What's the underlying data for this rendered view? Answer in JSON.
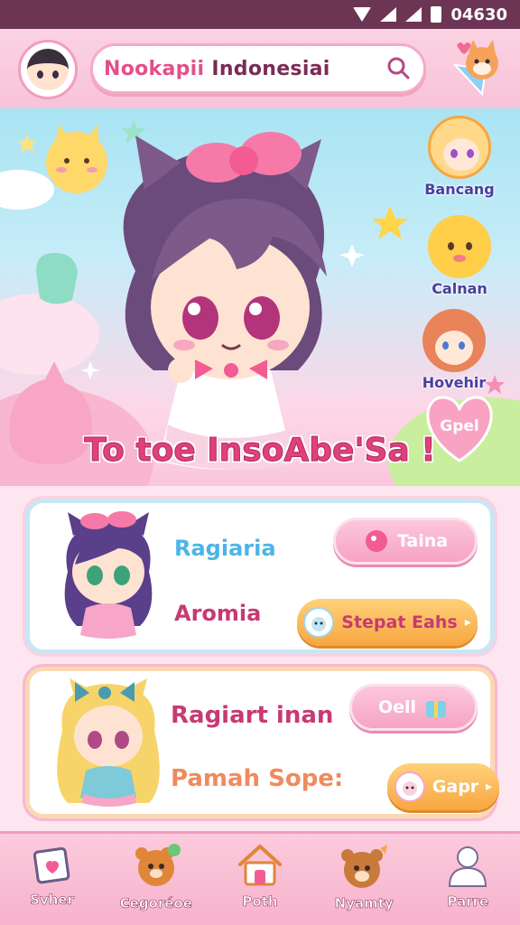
{
  "status_bar": {
    "time": "04630"
  },
  "header": {
    "title_part1": "Nookapii",
    "title_part2": "Indonesiai",
    "icons": [
      "avatar",
      "search-icon",
      "fox-badge-icon"
    ]
  },
  "hero": {
    "tagline": "To toe InsoAbe'Sa !",
    "side_characters": [
      {
        "label": "Bancang"
      },
      {
        "label": "Calnan"
      },
      {
        "label": "Hovehir"
      }
    ],
    "heart_button": "Gpel"
  },
  "cards": [
    {
      "title": "Ragiaria",
      "subtitle": "Aromia",
      "button_top": "Taina",
      "button_bottom": "Stepat Eahs"
    },
    {
      "title": "Ragiart inan",
      "subtitle": "Pamah Sope:",
      "button_top": "Oell",
      "button_bottom": "Gapr"
    }
  ],
  "bottom_nav": [
    {
      "label": "Svher",
      "icon": "card-heart-icon"
    },
    {
      "label": "Cegoréoe",
      "icon": "bear-icon"
    },
    {
      "label": "Poth",
      "icon": "home-icon"
    },
    {
      "label": "Nyamty",
      "icon": "bear-face-icon"
    },
    {
      "label": "Parre",
      "icon": "user-icon"
    }
  ],
  "colors": {
    "accent_pink": "#e2508b",
    "status_bar": "#6b3553",
    "nav_bg": "#f7b2cc"
  }
}
